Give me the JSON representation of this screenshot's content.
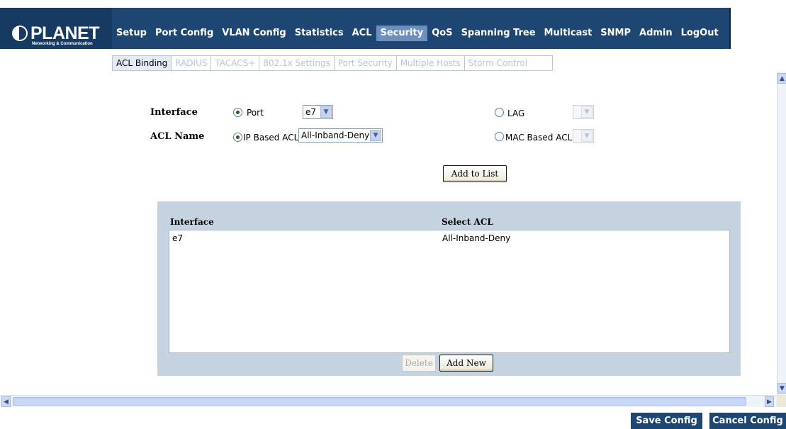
{
  "brand": {
    "name": "PLANET",
    "tagline": "Networking & Communication"
  },
  "menu": {
    "items": [
      {
        "label": "Setup"
      },
      {
        "label": "Port Config"
      },
      {
        "label": "VLAN Config"
      },
      {
        "label": "Statistics"
      },
      {
        "label": "ACL"
      },
      {
        "label": "Security",
        "active": true
      },
      {
        "label": "QoS"
      },
      {
        "label": "Spanning Tree"
      },
      {
        "label": "Multicast"
      },
      {
        "label": "SNMP"
      },
      {
        "label": "Admin"
      },
      {
        "label": "LogOut"
      }
    ]
  },
  "submenu": {
    "items": [
      {
        "label": "ACL Binding",
        "active": true
      },
      {
        "label": "RADIUS"
      },
      {
        "label": "TACACS+"
      },
      {
        "label": "802.1x Settings"
      },
      {
        "label": "Port Security"
      },
      {
        "label": "Multiple Hosts"
      },
      {
        "label": "Storm Control"
      }
    ]
  },
  "form": {
    "interface_label": "Interface",
    "acl_name_label": "ACL Name",
    "port_radio_label": "Port",
    "port_value": "e7",
    "lag_radio_label": "LAG",
    "lag_value": "",
    "ip_acl_radio_label": "IP Based ACL",
    "ip_acl_value": "All-Inband-Deny",
    "mac_acl_radio_label": "MAC Based ACL",
    "mac_acl_value": "",
    "add_to_list_label": "Add to List"
  },
  "table": {
    "columns": [
      "Interface",
      "Select ACL"
    ],
    "rows": [
      {
        "interface": "e7",
        "acl": "All-Inband-Deny"
      }
    ],
    "delete_label": "Delete",
    "add_new_label": "Add New"
  },
  "footer": {
    "save_label": "Save Config",
    "cancel_label": "Cancel Config"
  },
  "colors": {
    "nav_bg": "#1e4672",
    "active_tab": "#6d8fbd",
    "table_panel": "#c5d2df"
  }
}
